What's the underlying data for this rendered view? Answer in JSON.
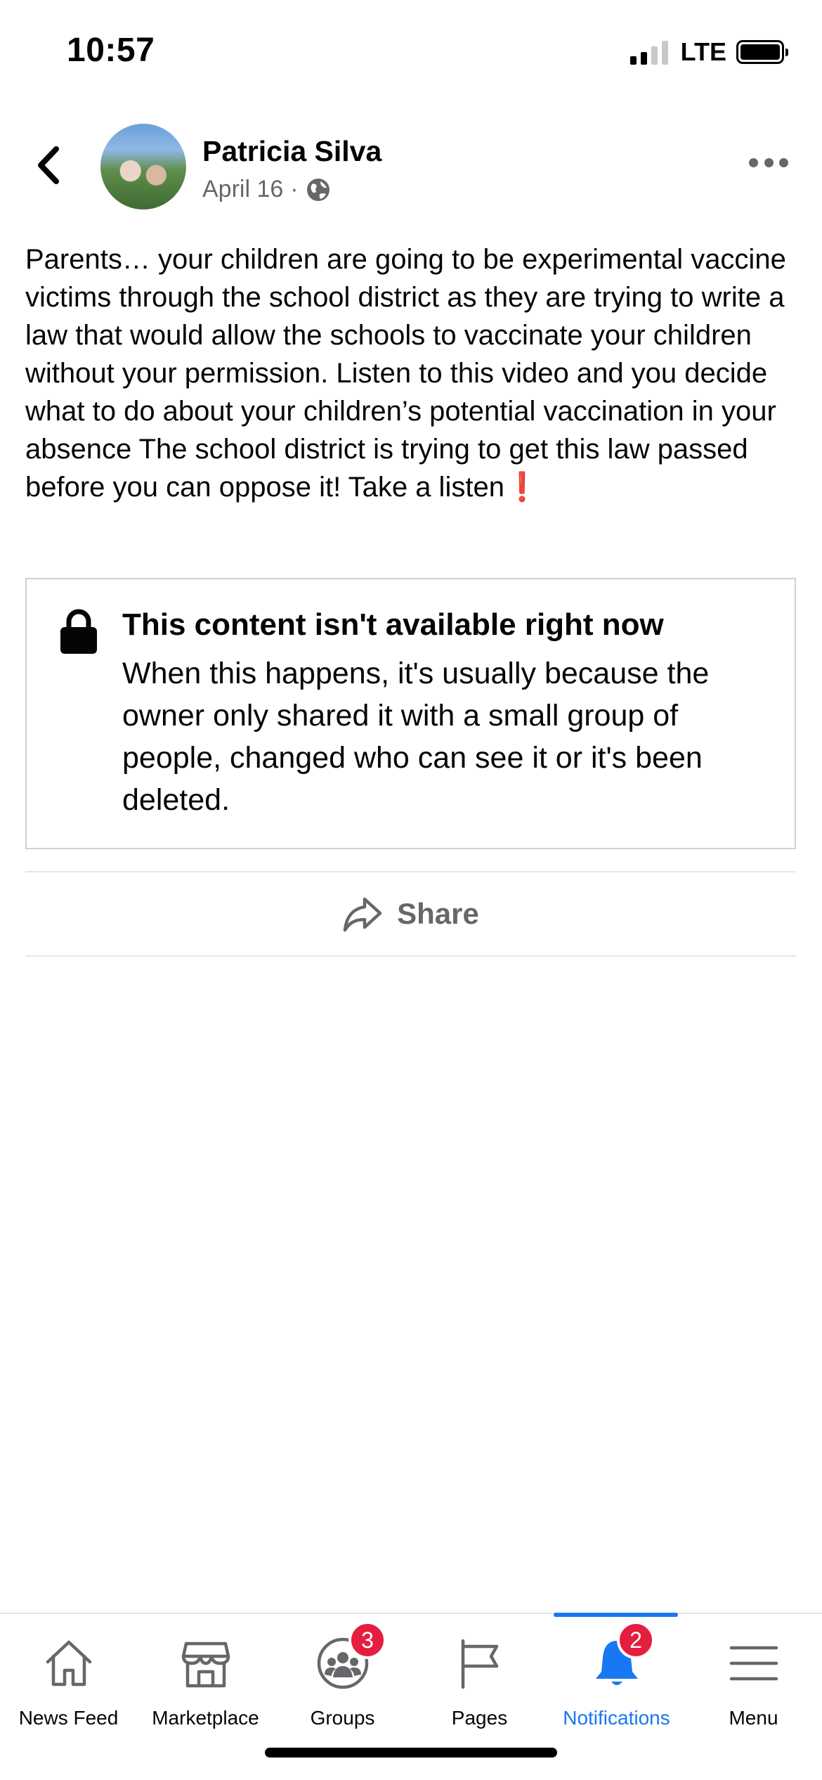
{
  "status_bar": {
    "time": "10:57",
    "network": "LTE"
  },
  "post": {
    "author": "Patricia Silva",
    "date": "April 16",
    "separator": "·",
    "privacy_icon": "globe-icon",
    "text": "Parents… your children are going to be experimental vaccine victims through the school district as they are trying to write a law that would allow the schools to vaccinate your children without your permission. Listen to this video and you decide what to do about your children’s potential vaccination in your absence The school district is trying to get this law passed before you can oppose it! Take a listen",
    "text_emoji": "❗"
  },
  "unavailable": {
    "title": "This content isn't available right now",
    "body": "When this happens, it's usually because the owner only shared it with a small group of people, changed who can see it or it's been deleted."
  },
  "actions": {
    "share_label": "Share"
  },
  "tab_bar": {
    "active_color": "#1877f2",
    "badge_color": "#e41e3f",
    "tabs": [
      {
        "label": "News Feed",
        "icon": "home-icon"
      },
      {
        "label": "Marketplace",
        "icon": "marketplace-icon"
      },
      {
        "label": "Groups",
        "icon": "groups-icon",
        "badge": "3"
      },
      {
        "label": "Pages",
        "icon": "flag-icon"
      },
      {
        "label": "Notifications",
        "icon": "bell-icon",
        "badge": "2",
        "active": true
      },
      {
        "label": "Menu",
        "icon": "menu-icon"
      }
    ]
  }
}
